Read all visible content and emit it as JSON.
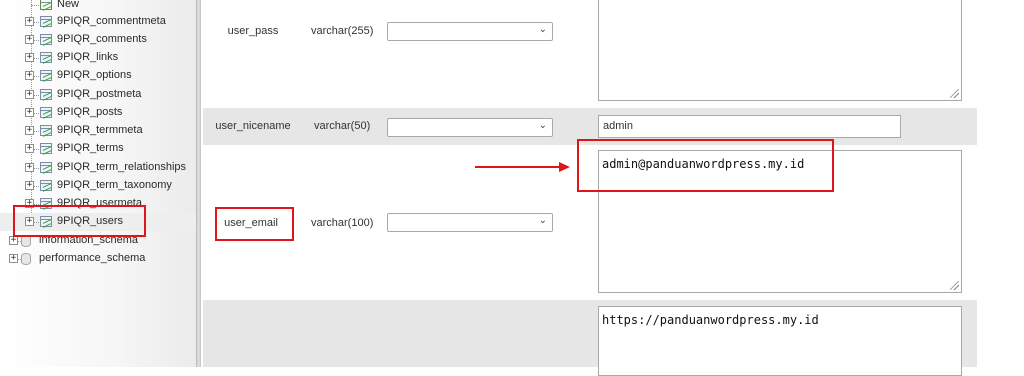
{
  "sidebar": {
    "new_label": "New",
    "tables": [
      {
        "label": "9PIQR_commentmeta"
      },
      {
        "label": "9PIQR_comments"
      },
      {
        "label": "9PIQR_links"
      },
      {
        "label": "9PIQR_options"
      },
      {
        "label": "9PIQR_postmeta"
      },
      {
        "label": "9PIQR_posts"
      },
      {
        "label": "9PIQR_termmeta"
      },
      {
        "label": "9PIQR_terms"
      },
      {
        "label": "9PIQR_term_relationships"
      },
      {
        "label": "9PIQR_term_taxonomy"
      },
      {
        "label": "9PIQR_usermeta"
      },
      {
        "label": "9PIQR_users"
      }
    ],
    "databases": [
      {
        "label": "information_schema"
      },
      {
        "label": "performance_schema"
      }
    ],
    "expander_glyph": "+"
  },
  "form": {
    "rows": [
      {
        "column": "user_pass",
        "type": "varchar(255)",
        "value": ""
      },
      {
        "column": "user_nicename",
        "type": "varchar(50)",
        "value": "admin"
      },
      {
        "column": "user_email",
        "type": "varchar(100)",
        "value": "admin@panduanwordpress.my.id"
      },
      {
        "column": "",
        "type": "",
        "value": "https://panduanwordpress.my.id"
      }
    ],
    "select_chevron": "⌄"
  },
  "colors": {
    "highlight": "#e0141b",
    "arrow": "#e0141b",
    "band_gray": "#e6e6e6"
  },
  "icons": {
    "table": "table-icon",
    "new": "new-table-icon",
    "database": "database-icon",
    "expander": "expand-icon",
    "select": "chevron-down-icon",
    "resize": "resize-grip-icon"
  }
}
